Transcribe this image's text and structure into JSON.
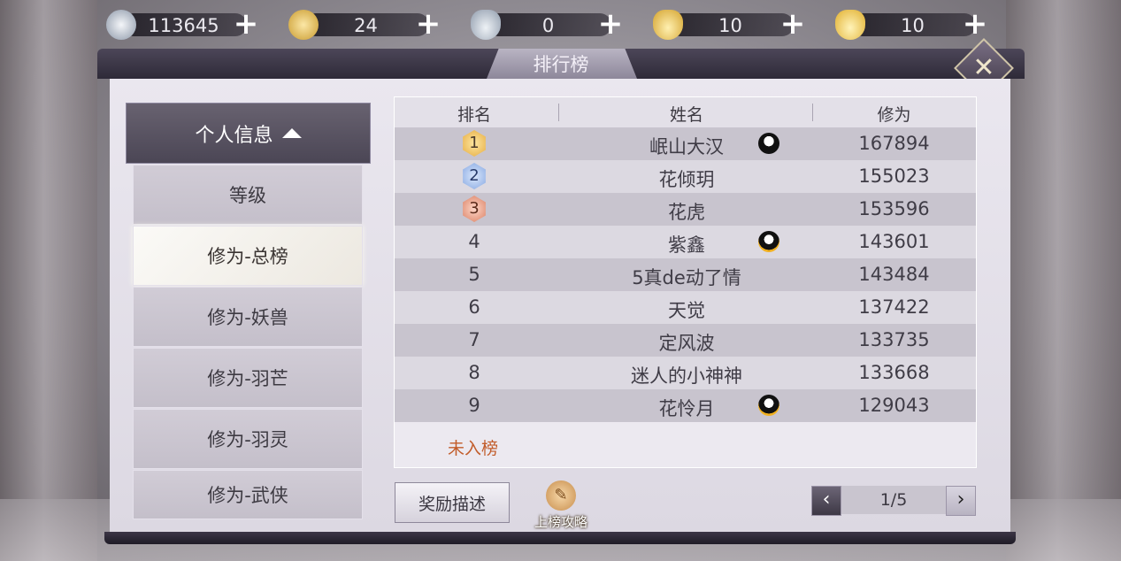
{
  "currencies": [
    {
      "icon": "silver-coin-icon",
      "value": "113645"
    },
    {
      "icon": "gold-coin-icon",
      "value": "24"
    },
    {
      "icon": "silver-ingot-icon",
      "value": "0"
    },
    {
      "icon": "bound-gold-ingot-icon",
      "value": "10"
    },
    {
      "icon": "gold-ingot-icon",
      "value": "10"
    }
  ],
  "window": {
    "title": "排行榜"
  },
  "sidebar": {
    "header": "个人信息",
    "items": [
      {
        "label": "等级",
        "active": false
      },
      {
        "label": "修为-总榜",
        "active": true
      },
      {
        "label": "修为-妖兽",
        "active": false
      },
      {
        "label": "修为-羽芒",
        "active": false
      },
      {
        "label": "修为-羽灵",
        "active": false
      },
      {
        "label": "修为-武侠",
        "active": false
      }
    ]
  },
  "table": {
    "headers": {
      "rank": "排名",
      "name": "姓名",
      "score": "修为"
    },
    "rows": [
      {
        "rank": "1",
        "name": "岷山大汉",
        "score": "167894",
        "medal": "gold",
        "qq": "plain"
      },
      {
        "rank": "2",
        "name": "花倾玥",
        "score": "155023",
        "medal": "silver",
        "qq": ""
      },
      {
        "rank": "3",
        "name": "花虎",
        "score": "153596",
        "medal": "bronze",
        "qq": ""
      },
      {
        "rank": "4",
        "name": "紫鑫",
        "score": "143601",
        "medal": "",
        "qq": "gold"
      },
      {
        "rank": "5",
        "name": "5真de动了情",
        "score": "143484",
        "medal": "",
        "qq": ""
      },
      {
        "rank": "6",
        "name": "天觉",
        "score": "137422",
        "medal": "",
        "qq": ""
      },
      {
        "rank": "7",
        "name": "定风波",
        "score": "133735",
        "medal": "",
        "qq": ""
      },
      {
        "rank": "8",
        "name": "迷人的小神神",
        "score": "133668",
        "medal": "",
        "qq": ""
      },
      {
        "rank": "9",
        "name": "花怜月",
        "score": "129043",
        "medal": "",
        "qq": "gold"
      }
    ],
    "self_status": "未入榜"
  },
  "footer": {
    "reward_label": "奖励描述",
    "guide_label": "上榜攻略",
    "page": "1/5"
  }
}
